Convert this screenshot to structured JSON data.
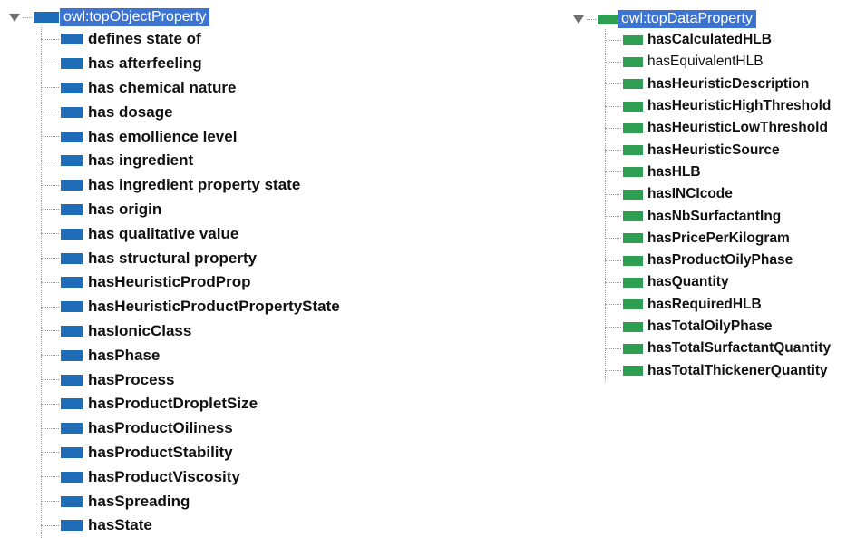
{
  "object_tree": {
    "root_label": "owl:topObjectProperty",
    "toggle_icon": "expanded-triangle-icon",
    "node_icon": "object-property-icon",
    "color": "#1f6db8",
    "items": [
      "defines state of",
      "has afterfeeling",
      "has chemical nature",
      "has dosage",
      "has emollience level",
      "has ingredient",
      "has ingredient property state",
      "has origin",
      "has qualitative value",
      "has structural property",
      "hasHeuristicProdProp",
      "hasHeuristicProductPropertyState",
      "hasIonicClass",
      "hasPhase",
      "hasProcess",
      "hasProductDropletSize",
      "hasProductOiliness",
      "hasProductStability",
      "hasProductViscosity",
      "hasSpreading",
      "hasState"
    ]
  },
  "data_tree": {
    "root_label": "owl:topDataProperty",
    "toggle_icon": "expanded-triangle-icon",
    "node_icon": "data-property-icon",
    "color": "#2e9e52",
    "items": [
      "hasCalculatedHLB",
      "hasEquivalentHLB",
      "hasHeuristicDescription",
      "hasHeuristicHighThreshold",
      "hasHeuristicLowThreshold",
      "hasHeuristicSource",
      "hasHLB",
      "hasINCIcode",
      "hasNbSurfactantIng",
      "hasPricePerKilogram",
      "hasProductOilyPhase",
      "hasQuantity",
      "hasRequiredHLB",
      "hasTotalOilyPhase",
      "hasTotalSurfactantQuantity",
      "hasTotalThickenerQuantity"
    ],
    "plain_items": [
      "hasEquivalentHLB"
    ]
  },
  "selection_color": "#3d74d1"
}
